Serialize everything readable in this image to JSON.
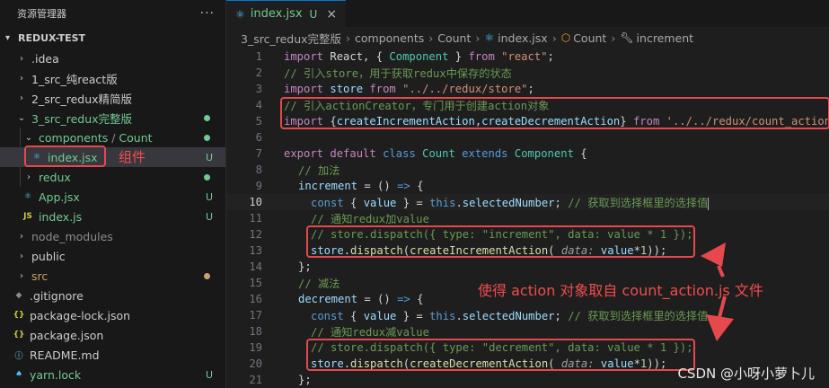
{
  "sidebar": {
    "title": "资源管理器",
    "more": "···",
    "project": "REDUX-TEST",
    "items": [
      {
        "label": ".idea",
        "status": ""
      },
      {
        "label": "1_src_纯react版",
        "status": ""
      },
      {
        "label": "2_src_redux精简版",
        "status": ""
      },
      {
        "label": "3_src_redux完整版",
        "status": ""
      },
      {
        "label": "components",
        "label2": "Count",
        "status": ""
      },
      {
        "label": "index.jsx",
        "status": "U"
      },
      {
        "label": "redux",
        "status": ""
      },
      {
        "label": "App.jsx",
        "status": "U"
      },
      {
        "label": "index.js",
        "status": "U"
      },
      {
        "label": "node_modules",
        "status": ""
      },
      {
        "label": "public",
        "status": ""
      },
      {
        "label": "src",
        "status": ""
      },
      {
        "label": ".gitignore",
        "status": ""
      },
      {
        "label": "package-lock.json",
        "status": ""
      },
      {
        "label": "package.json",
        "status": ""
      },
      {
        "label": "README.md",
        "status": ""
      },
      {
        "label": "yarn.lock",
        "status": "U"
      }
    ],
    "annotation": "组件"
  },
  "tab": {
    "label": "index.jsx",
    "status": "U",
    "close": "×"
  },
  "breadcrumb": [
    "3_src_redux完整版",
    "components",
    "Count",
    "index.jsx",
    "Count",
    "increment"
  ],
  "code": {
    "line_numbers": [
      "1",
      "2",
      "3",
      "4",
      "5",
      "6",
      "7",
      "8",
      "9",
      "10",
      "11",
      "12",
      "13",
      "14",
      "15",
      "16",
      "17",
      "18",
      "19",
      "20",
      "21"
    ],
    "l1": {
      "a": "import",
      "b": " React, { ",
      "c": "Component",
      "d": " } ",
      "e": "from",
      "f": " \"react\"",
      "g": ";"
    },
    "l2": "// 引入store，用于获取redux中保存的状态",
    "l3": {
      "a": "import",
      "b": "store",
      "c": "from",
      "d": "\"../../redux/store\"",
      "e": ";"
    },
    "l4": "// 引入actionCreator，专门用于创建action对象",
    "l5": {
      "a": "import",
      "b": " {",
      "c": "createIncrementAction",
      "d": ",",
      "e": "createDecrementAction",
      "f": "} ",
      "g": "from",
      "h": " '../../redux/count_action'"
    },
    "l7": {
      "a": "export",
      "b": "default",
      "c": "class",
      "d": "Count",
      "e": "extends",
      "f": "Component",
      "g": " {"
    },
    "l8": "// 加法",
    "l9": {
      "a": "increment",
      "b": " = () ",
      "c": "=>",
      "d": " {"
    },
    "l10": {
      "a": "const",
      "b": " { ",
      "c": "value",
      "d": " } = ",
      "e": "this",
      "f": ".",
      "g": "selectedNumber",
      "h": "; ",
      "i": "// 获取到选择框里的选择值"
    },
    "l11": "// 通知redux加value",
    "l12": "// store.dispatch({ type: \"increment\", data: value * 1 });",
    "l13": {
      "a": "store",
      "b": ".",
      "c": "dispatch",
      "d": "(",
      "e": "createIncrementAction",
      "f": "( ",
      "g": "data:",
      "h": " ",
      "i": "value",
      "j": "*",
      "k": "1",
      "l": "));"
    },
    "l14": "};",
    "l15": "// 减法",
    "l16": {
      "a": "decrement",
      "b": " = () ",
      "c": "=>",
      "d": " {"
    },
    "l17": {
      "a": "const",
      "b": " { ",
      "c": "value",
      "d": " } = ",
      "e": "this",
      "f": ".",
      "g": "selectedNumber",
      "h": "; ",
      "i": "// 获取到选择框里的选择值"
    },
    "l18": "// 通知redux减value",
    "l19": "// store.dispatch({ type: \"decrement\", data: value * 1 });",
    "l20": {
      "a": "store",
      "b": ".",
      "c": "dispatch",
      "d": "(",
      "e": "createDecrementAction",
      "f": "( ",
      "g": "data:",
      "h": " ",
      "i": "value",
      "j": "*",
      "k": "1",
      "l": "));"
    },
    "l21": "};"
  },
  "annotation_main": "使得 action 对象取自 count_action.js 文件",
  "watermark": "CSDN @小呀小萝卜儿",
  "colors": {
    "accent": "#0078d4",
    "annotation": "#e5484d",
    "untracked": "#73c991"
  }
}
